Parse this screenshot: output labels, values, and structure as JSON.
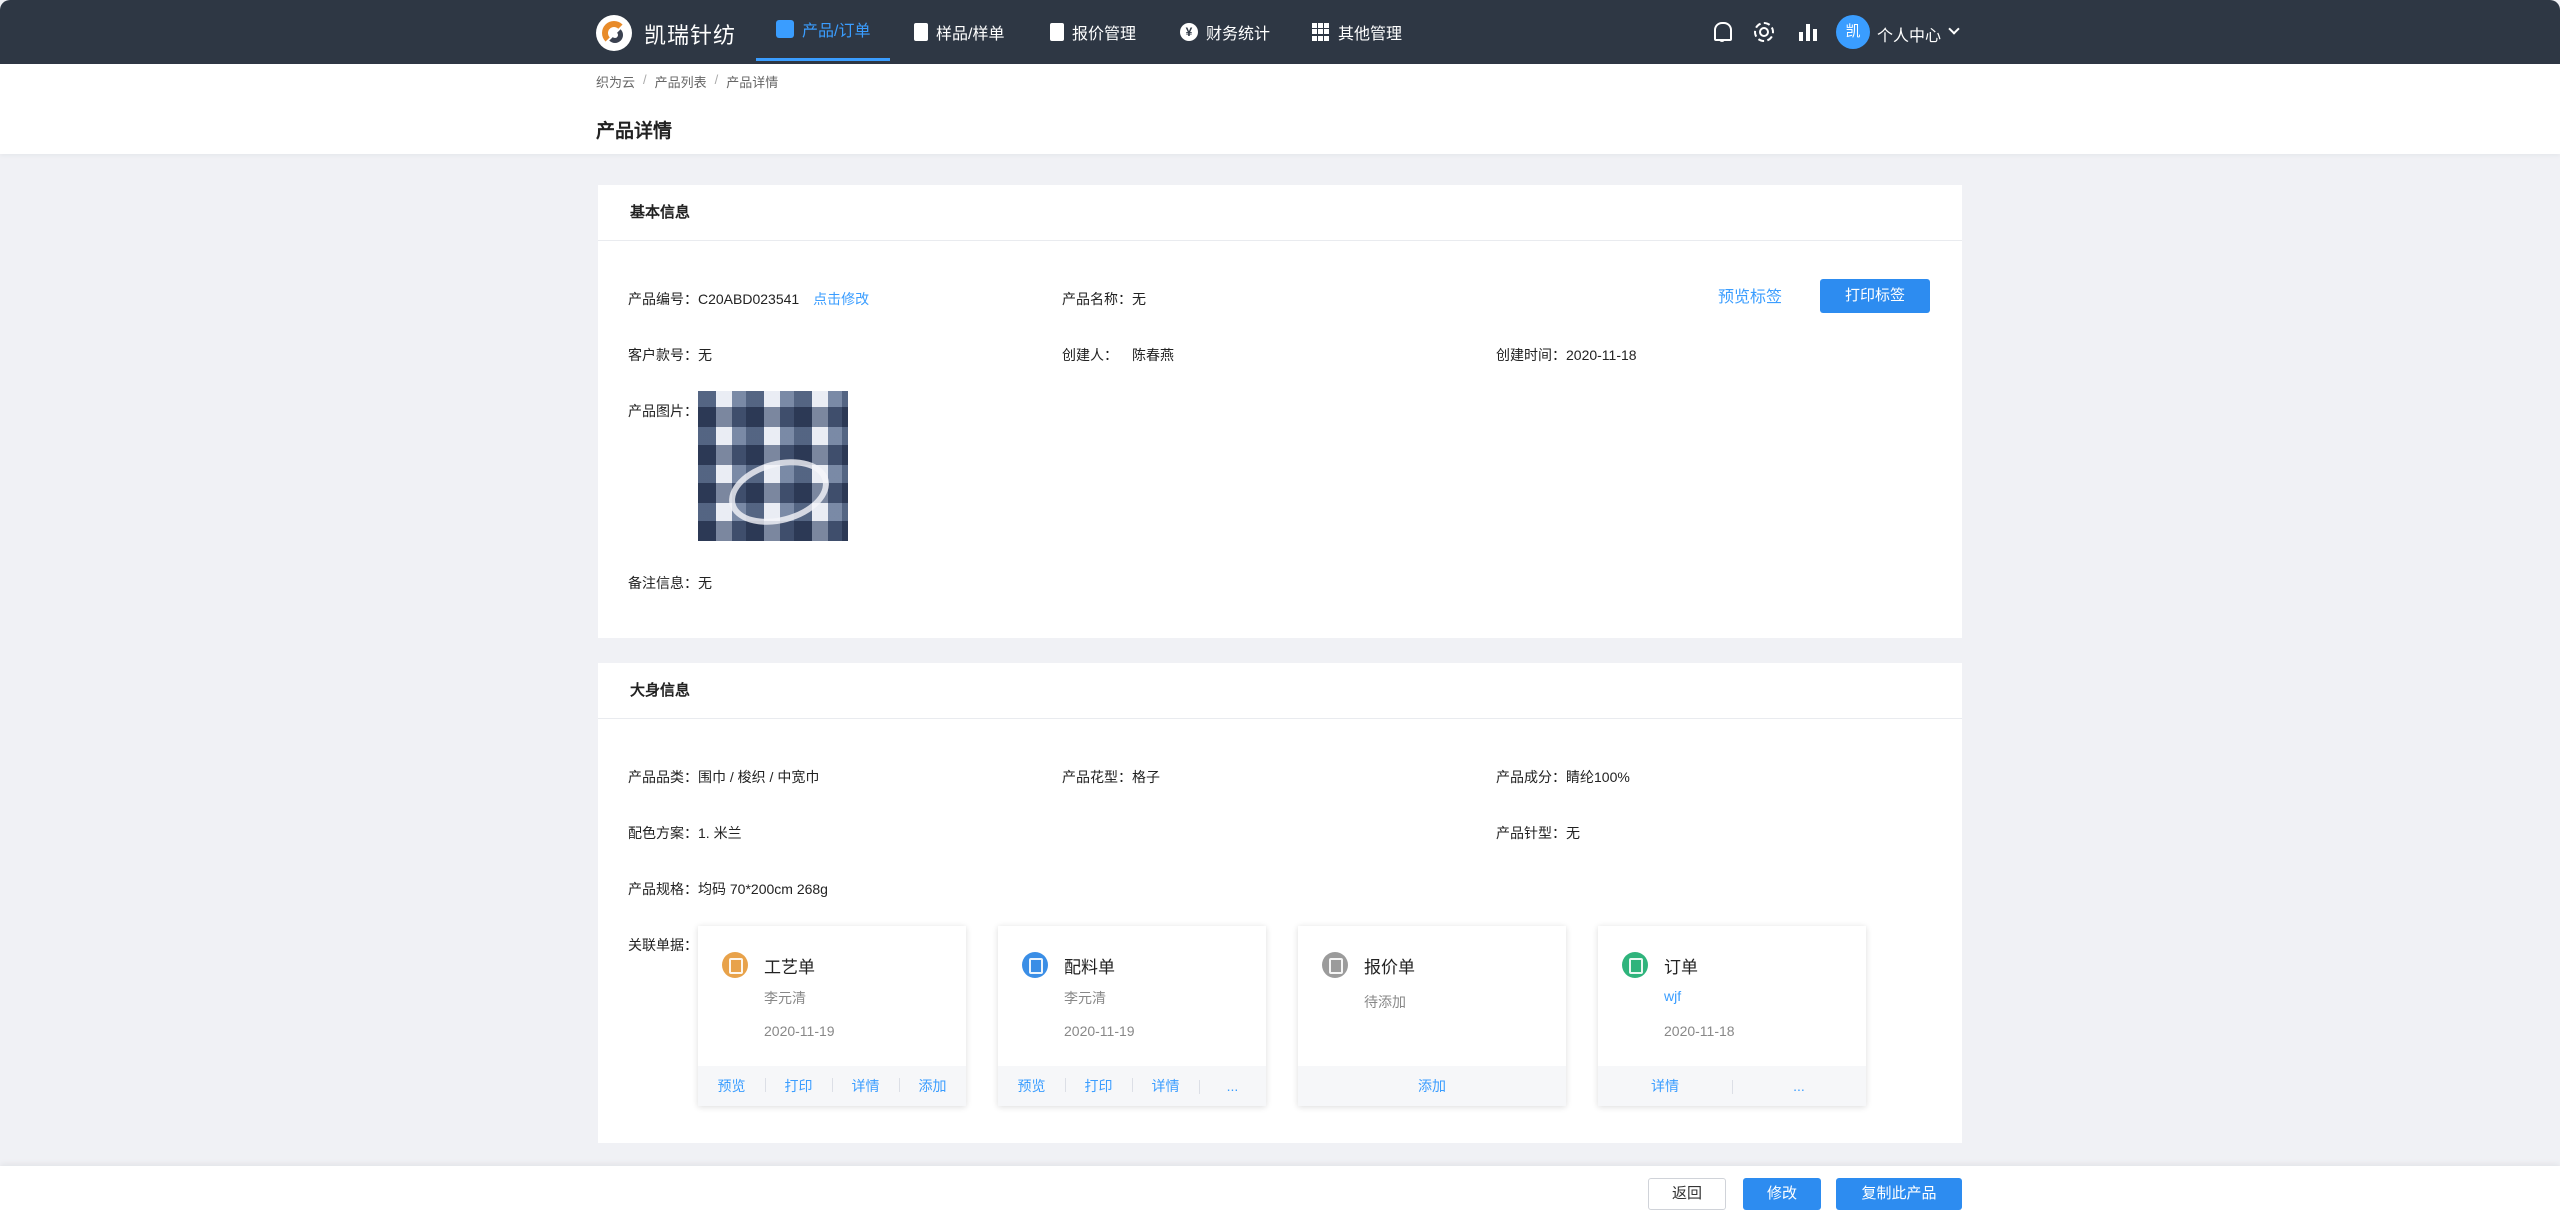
{
  "app": {
    "brand": "凯瑞针纺"
  },
  "nav": {
    "items": [
      {
        "label": "产品/订单",
        "icon": "cube-icon",
        "active": true
      },
      {
        "label": "样品/样单",
        "icon": "clipboard-icon"
      },
      {
        "label": "报价管理",
        "icon": "calculator-icon"
      },
      {
        "label": "财务统计",
        "icon": "yen-icon"
      },
      {
        "label": "其他管理",
        "icon": "grid-icon"
      }
    ],
    "right_icons": [
      "bell-icon",
      "gear-icon",
      "bar-chart-icon"
    ],
    "avatar_text": "凯",
    "user_label": "个人中心"
  },
  "breadcrumb": [
    "织为云",
    "产品列表",
    "产品详情"
  ],
  "page_title": "产品详情",
  "basic": {
    "title": "基本信息",
    "product_no_label": "产品编号：",
    "product_no": "C20ABD023541",
    "edit_link": "点击修改",
    "name_label": "产品名称：",
    "name": "无",
    "customer_no_label": "客户款号：",
    "customer_no": "无",
    "creator_label": "创建人：",
    "creator": "陈春燕",
    "created_label": "创建时间：",
    "created": "2020-11-18",
    "image_label": "产品图片：",
    "remark_label": "备注信息：",
    "remark": "无",
    "preview_label_btn": "预览标签",
    "print_label_btn": "打印标签"
  },
  "body": {
    "title": "大身信息",
    "category_label": "产品品类：",
    "category": "围巾 / 梭织 / 中宽巾",
    "pattern_label": "产品花型：",
    "pattern": "格子",
    "composition_label": "产品成分：",
    "composition": "睛纶100%",
    "color_label": "配色方案：",
    "color": "1. 米兰",
    "needle_label": "产品针型：",
    "needle": "无",
    "spec_label": "产品规格：",
    "spec": "均码 70*200cm 268g",
    "related_label": "关联单据："
  },
  "docs": [
    {
      "title": "工艺单",
      "person": "李元清",
      "date": "2020-11-19",
      "icon_color": "#e8a24a",
      "actions": [
        "预览",
        "打印",
        "详情",
        "添加"
      ]
    },
    {
      "title": "配料单",
      "person": "李元清",
      "date": "2020-11-19",
      "icon_color": "#3a8ee6",
      "actions": [
        "预览",
        "打印",
        "详情",
        "..."
      ]
    },
    {
      "title": "报价单",
      "person": "待添加",
      "date": "",
      "icon_color": "#9b9b9b",
      "actions": [
        "添加"
      ]
    },
    {
      "title": "订单",
      "person": "wjf",
      "date": "2020-11-18",
      "icon_color": "#2fb47c",
      "actions": [
        "详情",
        "..."
      ]
    }
  ],
  "footer": {
    "back": "返回",
    "edit": "修改",
    "copy": "复制此产品"
  },
  "colors": {
    "nav_bg": "#2e3744",
    "accent": "#2d8cf0",
    "page_bg": "#f0f1f5"
  }
}
